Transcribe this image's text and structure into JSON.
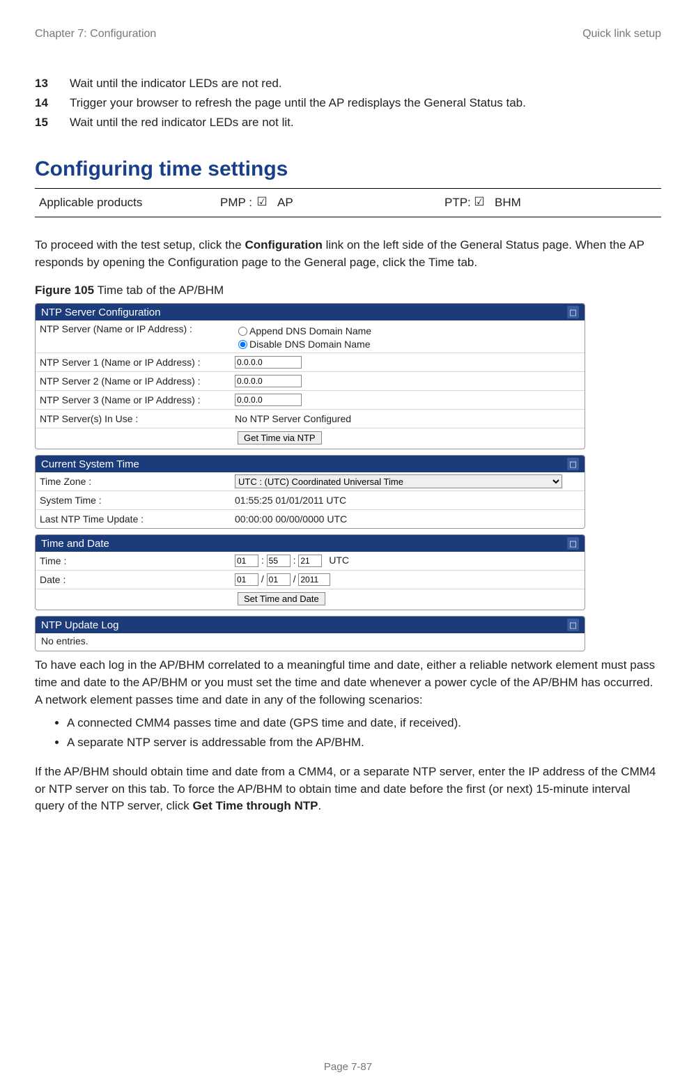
{
  "header": {
    "left": "Chapter 7:  Configuration",
    "right": "Quick link setup"
  },
  "steps": [
    {
      "num": "13",
      "text": "Wait until the indicator LEDs are not red."
    },
    {
      "num": "14",
      "text": "Trigger your browser to refresh the page until the AP redisplays the General Status tab."
    },
    {
      "num": "15",
      "text": "Wait until the red indicator LEDs are not lit."
    }
  ],
  "section_heading": "Configuring time settings",
  "applicable": {
    "label": "Applicable products",
    "pmp_label": "PMP :",
    "pmp_check": "☑",
    "pmp_item": "AP",
    "ptp_label": "PTP:",
    "ptp_check": "☑",
    "ptp_item": "BHM"
  },
  "intro_para_pre": "To proceed with the test setup, click the ",
  "intro_para_bold": "Configuration",
  "intro_para_post": " link on the left side of the General Status page. When the AP responds by opening the Configuration page to the General page, click the Time tab.",
  "figure_label_bold": "Figure 105",
  "figure_label_rest": " Time tab of the AP/BHM",
  "panels": {
    "ntp_config": {
      "title": "NTP Server Configuration",
      "rows": {
        "dns_label": "NTP Server (Name or IP Address) :",
        "dns_opt_append": "Append DNS Domain Name",
        "dns_opt_disable": "Disable DNS Domain Name",
        "srv1_label": "NTP Server 1 (Name or IP Address) :",
        "srv1_val": "0.0.0.0",
        "srv2_label": "NTP Server 2 (Name or IP Address) :",
        "srv2_val": "0.0.0.0",
        "srv3_label": "NTP Server 3 (Name or IP Address) :",
        "srv3_val": "0.0.0.0",
        "inuse_label": "NTP Server(s) In Use :",
        "inuse_val": "No NTP Server Configured",
        "button": "Get Time via NTP"
      }
    },
    "current_time": {
      "title": "Current System Time",
      "tz_label": "Time Zone :",
      "tz_value": "UTC : (UTC) Coordinated Universal Time",
      "sys_label": "System Time :",
      "sys_value": "01:55:25 01/01/2011 UTC",
      "last_label": "Last NTP Time Update :",
      "last_value": "00:00:00 00/00/0000 UTC"
    },
    "time_date": {
      "title": "Time and Date",
      "time_label": "Time :",
      "time_h": "01",
      "time_m": "55",
      "time_s": "21",
      "time_sep": ":",
      "time_tz": "UTC",
      "date_label": "Date :",
      "date_m": "01",
      "date_d": "01",
      "date_y": "2011",
      "date_sep": "/",
      "button": "Set Time and Date"
    },
    "ntp_log": {
      "title": "NTP Update Log",
      "body": "No entries."
    }
  },
  "after_figure_para": "To have each log in the AP/BHM correlated to a meaningful time and date, either a reliable network element must pass time and date to the AP/BHM or you must set the time and date whenever a power cycle of the AP/BHM has occurred. A network element passes time and date in any of the following scenarios:",
  "bullets": [
    "A connected CMM4 passes time and date (GPS time and date, if received).",
    "A separate NTP server is addressable from the AP/BHM."
  ],
  "final_para_pre": "If the AP/BHM should obtain time and date from a CMM4, or a separate NTP server, enter the IP address of the CMM4 or NTP server on this tab. To force the AP/BHM to obtain time and date before the first (or next) 15-minute interval query of the NTP server, click ",
  "final_para_bold": "Get Time through NTP",
  "final_para_post": ".",
  "footer": "Page 7-87"
}
